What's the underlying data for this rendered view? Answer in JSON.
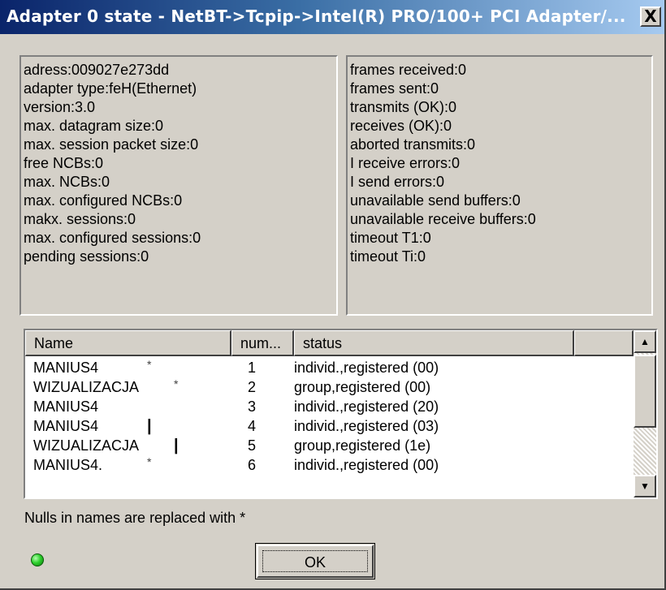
{
  "window": {
    "title": "Adapter 0 state - NetBT->Tcpip->Intel(R) PRO/100+ PCI Adapter/...",
    "close_label": "X"
  },
  "adapter_info": [
    "adress:009027e273dd",
    "adapter type:feH(Ethernet)",
    "version:3.0",
    "max. datagram size:0",
    "max. session packet size:0",
    "free NCBs:0",
    "max. NCBs:0",
    "max. configured NCBs:0",
    "makx. sessions:0",
    "max. configured sessions:0",
    "pending sessions:0"
  ],
  "stats_info": [
    "frames received:0",
    "frames sent:0",
    "transmits (OK):0",
    "receives (OK):0",
    "aborted transmits:0",
    "I receive errors:0",
    "I send errors:0",
    "unavailable send buffers:0",
    "unavailable receive buffers:0",
    "timeout T1:0",
    "timeout Ti:0"
  ],
  "names_table": {
    "columns": [
      "Name",
      "num...",
      "status",
      ""
    ],
    "rows": [
      {
        "name": "MANIUS4",
        "mark": "*",
        "num": "1",
        "status": "individ.,registered (00)"
      },
      {
        "name": "WIZUALIZACJA",
        "mark": "*",
        "num": "2",
        "status": "group,registered (00)"
      },
      {
        "name": "MANIUS4",
        "mark": "",
        "num": "3",
        "status": "individ.,registered (20)"
      },
      {
        "name": "MANIUS4",
        "mark": "|",
        "num": "4",
        "status": "individ.,registered (03)"
      },
      {
        "name": "WIZUALIZACJA",
        "mark": "|",
        "num": "5",
        "status": "group,registered (1e)"
      },
      {
        "name": "MANIUS4.",
        "mark": "*",
        "num": "6",
        "status": "individ.,registered (00)"
      }
    ]
  },
  "note": "Nulls in names are replaced with *",
  "ok_label": "OK",
  "colors": {
    "titlebar_start": "#0a246a",
    "titlebar_end": "#a6caf0",
    "dialog_bg": "#d4d0c8",
    "status_led": "#2ed12e"
  },
  "icons": {
    "close": "close-icon",
    "scroll_up": "arrow-up-icon",
    "scroll_down": "arrow-down-icon",
    "status": "status-led-icon"
  }
}
